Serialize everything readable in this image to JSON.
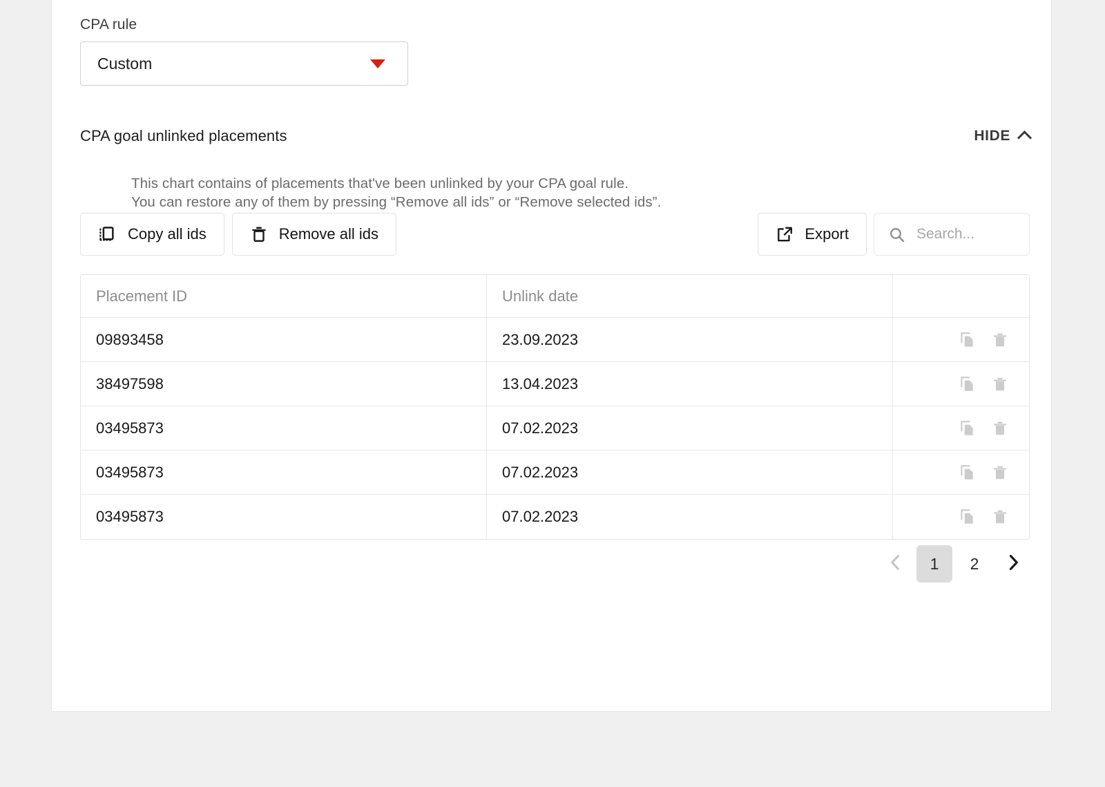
{
  "form": {
    "cpa_rule_label": "CPA rule",
    "cpa_rule_value": "Custom",
    "cpa_rule_caret_icon": "caret-down-icon"
  },
  "section": {
    "title": "CPA goal unlinked placements",
    "hide_label": "HIDE",
    "hide_icon": "chevron-up-icon",
    "description": "This chart contains of placements that've been unlinked by your CPA goal rule.\nYou can restore any of them by pressing “Remove all ids” or “Remove selected ids”."
  },
  "toolbar": {
    "copy_all_label": "Copy all ids",
    "copy_all_icon": "copy-icon",
    "remove_all_label": "Remove all ids",
    "remove_all_icon": "trash-icon",
    "export_label": "Export",
    "export_icon": "export-icon",
    "search_placeholder": "Search...",
    "search_value": "",
    "search_icon": "search-icon"
  },
  "table": {
    "columns": [
      "Placement ID",
      "Unlink date",
      ""
    ],
    "rows": [
      {
        "placement_id": "09893458",
        "unlink_date": "23.09.2023"
      },
      {
        "placement_id": "38497598",
        "unlink_date": "13.04.2023"
      },
      {
        "placement_id": "03495873",
        "unlink_date": "07.02.2023"
      },
      {
        "placement_id": "03495873",
        "unlink_date": "07.02.2023"
      },
      {
        "placement_id": "03495873",
        "unlink_date": "07.02.2023"
      }
    ],
    "row_copy_icon": "copy-icon",
    "row_delete_icon": "trash-icon"
  },
  "pagination": {
    "prev_icon": "chevron-left-icon",
    "next_icon": "chevron-right-icon",
    "pages": [
      "1",
      "2"
    ],
    "active_page": "1"
  },
  "colors": {
    "page_background": "#f0f0f0",
    "card_background": "#ffffff",
    "accent_red": "#d81f12",
    "text_primary": "#1d1d1d",
    "text_muted": "#8c8c8c",
    "border": "#e4e4e4",
    "active_page_background": "#dcdcdc"
  }
}
